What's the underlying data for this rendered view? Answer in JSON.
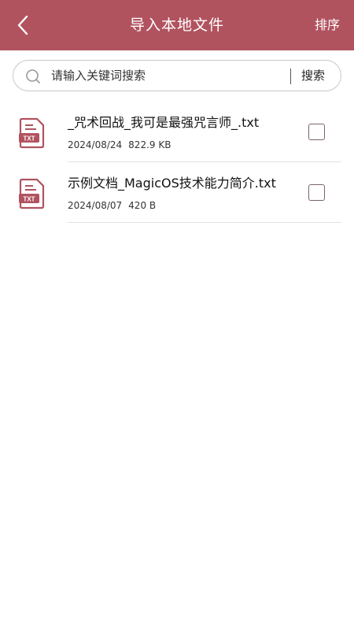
{
  "header": {
    "title": "导入本地文件",
    "sort_label": "排序"
  },
  "search": {
    "placeholder": "请输入关键词搜索",
    "button_label": "搜索"
  },
  "files": [
    {
      "name": "_咒术回战_我可是最强咒言师_.txt",
      "date": "2024/08/24",
      "size": "822.9 KB",
      "icon": "txt-file-icon",
      "checked": false
    },
    {
      "name": "示例文档_MagicOS技术能力简介.txt",
      "date": "2024/08/07",
      "size": "420 B",
      "icon": "txt-file-icon",
      "checked": false
    }
  ],
  "colors": {
    "accent": "#b1535f",
    "icon": "#b1535f"
  }
}
